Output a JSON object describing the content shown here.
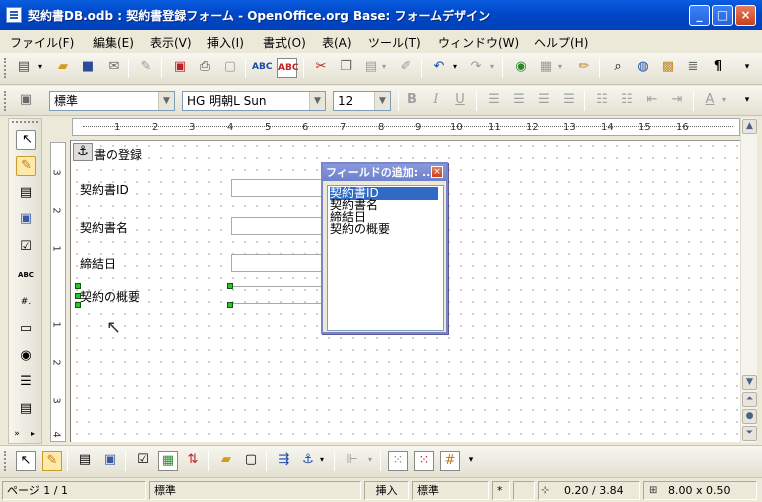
{
  "window": {
    "title": "契約書DB.odb : 契約書登録フォーム - OpenOffice.org Base: フォームデザイン",
    "controls": {
      "minimize": "_",
      "maximize": "□",
      "close": "×"
    }
  },
  "menu": {
    "items": [
      "ファイル(F)",
      "編集(E)",
      "表示(V)",
      "挿入(I)",
      "書式(O)",
      "表(A)",
      "ツール(T)",
      "ウィンドウ(W)",
      "ヘルプ(H)"
    ]
  },
  "formatting": {
    "paragraph_style": "標準",
    "font_name": "HG 明朝L Sun",
    "font_size": "12",
    "bold": "B",
    "italic": "I",
    "underline": "U"
  },
  "ruler": {
    "horizontal_ticks": [
      "1",
      "2",
      "3",
      "4",
      "5",
      "6",
      "7",
      "8",
      "9",
      "10",
      "11",
      "12",
      "13",
      "14",
      "15",
      "16"
    ],
    "vertical_ticks": [
      "3",
      "2",
      "1",
      "1",
      "2",
      "3",
      "4"
    ]
  },
  "form": {
    "heading": "書の登録",
    "labels": {
      "contract_id": "契約書ID",
      "contract_name": "契約書名",
      "signed_date": "締結日",
      "summary": "契約の概要"
    }
  },
  "add_field_dialog": {
    "title": "フィールドの追加: ...",
    "fields": [
      "契約書ID",
      "契約書名",
      "締結日",
      "契約の概要"
    ],
    "selected_index": 0
  },
  "status": {
    "page": "ページ 1 / 1",
    "page_style": "標準",
    "insert_mode": "挿入",
    "selection_mode": "標準",
    "modified": "*",
    "position": "0.20 / 3.84",
    "size": "8.00 x 0.50"
  },
  "colors": {
    "title_bar": "#0047C8",
    "selection": "#316AC5",
    "handle": "#2ec32e",
    "dialog_title": "#7B85C8"
  },
  "icons": {
    "toolbar_left": [
      "select-arrow-icon",
      "design-mode-icon",
      "control-icon",
      "form-icon",
      "checkbox-icon",
      "textfield-icon",
      "formatted-field-icon",
      "push-button-icon",
      "option-button-icon",
      "listbox-icon",
      "combobox-icon"
    ]
  }
}
